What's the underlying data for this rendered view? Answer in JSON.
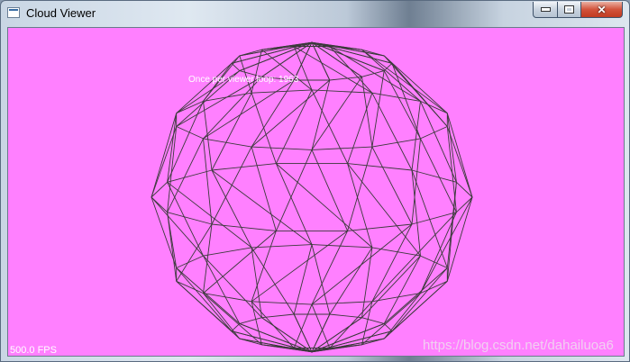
{
  "window": {
    "title": "Cloud Viewer",
    "icon": "app-window-icon",
    "controls": {
      "minimize": "minimize-icon",
      "maximize": "maximize-icon",
      "close": "close-icon"
    }
  },
  "viewer": {
    "background": "#ff80ff",
    "wire_color": "#3a3a3a",
    "overlay_text": "Once per viewer loop: 1963",
    "fps_text": "500.0 FPS",
    "watermark": "https://blog.csdn.net/dahailuoa6"
  }
}
